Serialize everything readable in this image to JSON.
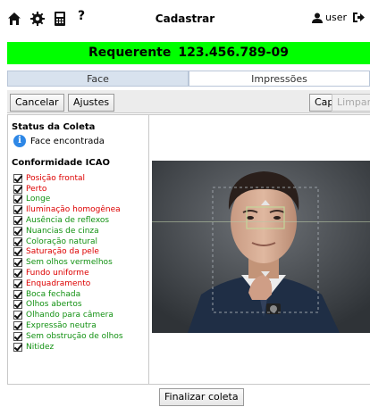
{
  "header": {
    "title": "Cadastrar",
    "user_label": "user",
    "help_label": "?"
  },
  "banner": {
    "label": "Requerente",
    "number": "123.456.789-09",
    "color": "#00ff00"
  },
  "tabs": [
    {
      "label": "Face",
      "active": true
    },
    {
      "label": "Impressões",
      "active": false
    }
  ],
  "toolbar": {
    "cancel_label": "Cancelar",
    "settings_label": "Ajustes",
    "capture_label": "Capturar",
    "clear_label": "Limpar"
  },
  "status": {
    "title": "Status da Coleta",
    "message": "Face encontrada"
  },
  "icao": {
    "title": "Conformidade ICAO",
    "items": [
      {
        "label": "Posição frontal",
        "checked": true,
        "status": "fail"
      },
      {
        "label": "Perto",
        "checked": true,
        "status": "fail"
      },
      {
        "label": "Longe",
        "checked": true,
        "status": "pass"
      },
      {
        "label": "Iluminação homogênea",
        "checked": true,
        "status": "fail"
      },
      {
        "label": "Ausência de reflexos",
        "checked": true,
        "status": "pass"
      },
      {
        "label": "Nuancias de cinza",
        "checked": true,
        "status": "pass"
      },
      {
        "label": "Coloração natural",
        "checked": true,
        "status": "pass"
      },
      {
        "label": "Saturação da pele",
        "checked": true,
        "status": "fail"
      },
      {
        "label": "Sem olhos vermelhos",
        "checked": true,
        "status": "pass"
      },
      {
        "label": "Fundo uniforme",
        "checked": true,
        "status": "fail"
      },
      {
        "label": "Enquadramento",
        "checked": true,
        "status": "fail"
      },
      {
        "label": "Boca fechada",
        "checked": true,
        "status": "pass"
      },
      {
        "label": "Olhos abertos",
        "checked": true,
        "status": "pass"
      },
      {
        "label": "Olhando para câmera",
        "checked": true,
        "status": "pass"
      },
      {
        "label": "Expressão neutra",
        "checked": true,
        "status": "pass"
      },
      {
        "label": "Sem obstrução de olhos",
        "checked": true,
        "status": "pass"
      },
      {
        "label": "Nitidez",
        "checked": true,
        "status": "pass"
      }
    ]
  },
  "footer": {
    "finish_label": "Finalizar coleta"
  },
  "icons": {
    "home": "home-icon",
    "settings": "gear-icon",
    "device": "device-icon",
    "help": "help-icon",
    "user": "user-icon",
    "logout": "logout-icon",
    "info": "info-icon"
  }
}
